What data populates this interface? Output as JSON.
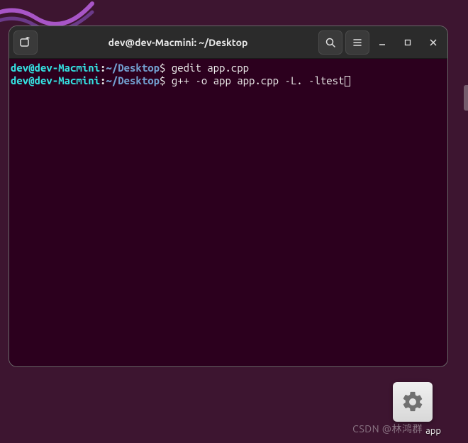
{
  "window": {
    "title": "dev@dev-Macmini: ~/Desktop"
  },
  "prompt": {
    "user_host": "dev@dev-Macmini",
    "colon": ":",
    "path": "~/Desktop",
    "symbol": "$"
  },
  "lines": [
    {
      "command": " gedit app.cpp"
    },
    {
      "command": " g++ -o app app.cpp -L. -ltest"
    }
  ],
  "desktop": {
    "app_label": "app"
  },
  "watermark": "CSDN @林鸿群",
  "icons": {
    "new_tab": "new-tab-icon",
    "search": "search-icon",
    "menu": "menu-icon",
    "minimize": "minimize-icon",
    "maximize": "maximize-icon",
    "close": "close-icon",
    "gear": "gear-icon"
  }
}
